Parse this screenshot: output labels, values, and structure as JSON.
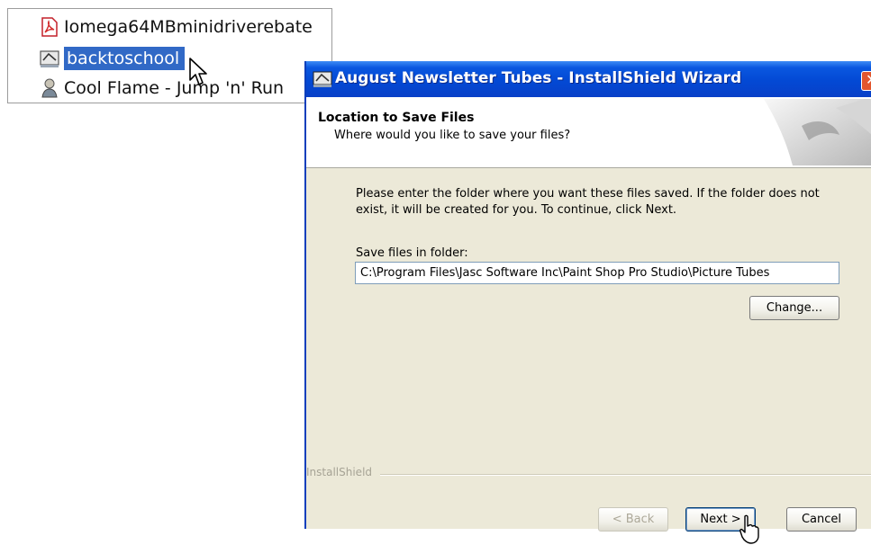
{
  "file_list": {
    "items": [
      {
        "label": "Iomega64MBminidriverebate",
        "icon": "pdf-icon",
        "selected": false
      },
      {
        "label": "backtoschool",
        "icon": "installer-icon",
        "selected": true
      },
      {
        "label": "Cool Flame - Jump 'n' Run",
        "icon": "figure-icon",
        "selected": false
      }
    ],
    "selection_color": "#3169c6"
  },
  "wizard": {
    "title": "August Newsletter Tubes - InstallShield Wizard",
    "header_title": "Location to Save Files",
    "header_subtitle": "Where would you like to save your files?",
    "instructions": "Please enter the folder where you want these files saved.  If the folder does not exist, it will be created for you.   To continue, click Next.",
    "folder_label": "Save files in folder:",
    "folder_value": "C:\\Program Files\\Jasc Software Inc\\Paint Shop Pro Studio\\Picture Tubes",
    "change_label": "Change...",
    "brand": "InstallShield",
    "back_label": "< Back",
    "next_label": "Next >",
    "cancel_label": "Cancel",
    "titlebar_color": "#0349d4",
    "dialog_color": "#ece9d8"
  }
}
